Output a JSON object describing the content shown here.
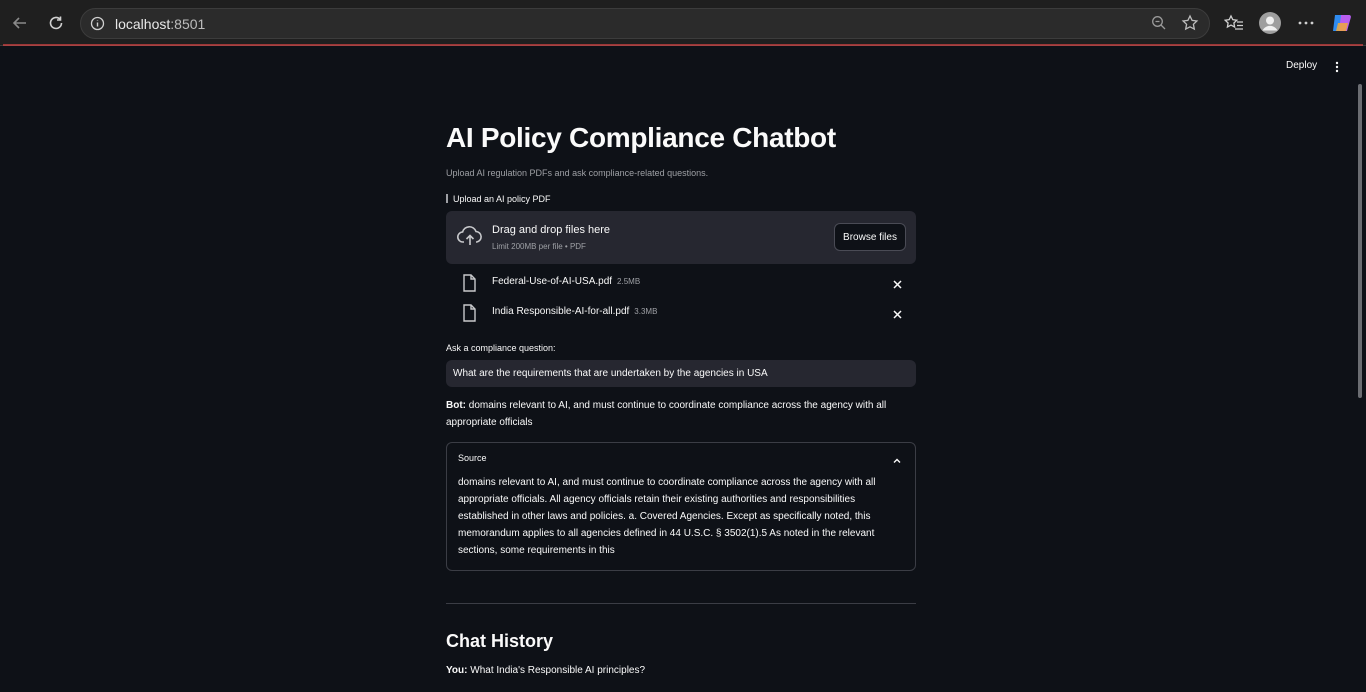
{
  "browser": {
    "url_host": "localhost",
    "url_port": ":8501"
  },
  "toolbar": {
    "deploy_label": "Deploy"
  },
  "page": {
    "title": "AI Policy Compliance Chatbot",
    "subtitle": "Upload AI regulation PDFs and ask compliance-related questions."
  },
  "uploader": {
    "label": "Upload an AI policy PDF",
    "drop_text": "Drag and drop files here",
    "limit_text": "Limit 200MB per file • PDF",
    "browse_label": "Browse files",
    "files": [
      {
        "name": "Federal-Use-of-AI-USA.pdf",
        "size": "2.5MB"
      },
      {
        "name": "India Responsible-AI-for-all.pdf",
        "size": "3.3MB"
      }
    ]
  },
  "question": {
    "label": "Ask a compliance question:",
    "value": "What are the requirements that are undertaken by the agencies in USA"
  },
  "answer": {
    "prefix": "Bot:",
    "text": " domains relevant to AI, and must continue to coordinate compliance across the agency with all appropriate officials"
  },
  "source": {
    "header": "Source",
    "text": "domains relevant to AI, and must continue to coordinate compliance across the agency with all appropriate officials. All agency officials retain their existing authorities and responsibilities established in other laws and policies. a. Covered Agencies. Except as specifically noted, this memorandum applies to all agencies defined in 44 U.S.C. § 3502(1).5 As noted in the relevant sections, some requirements in this"
  },
  "history": {
    "title": "Chat History",
    "items": [
      {
        "speaker": "You:",
        "text": " What India's Responsible AI principles?"
      }
    ]
  }
}
